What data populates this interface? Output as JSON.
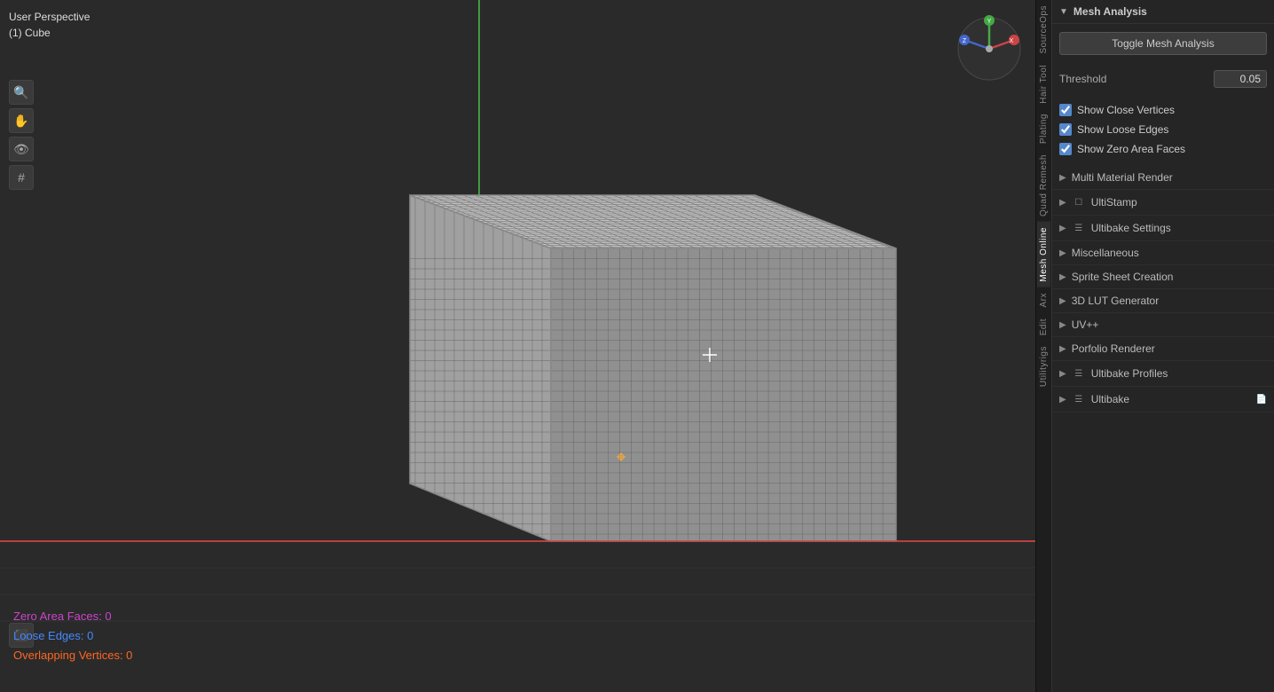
{
  "viewport": {
    "label_line1": "User Perspective",
    "label_line2": "(1) Cube"
  },
  "stats": {
    "zero_area": "Zero Area Faces: 0",
    "loose_edges": "Loose Edges: 0",
    "overlapping": "Overlapping Vertices: 0"
  },
  "toolbar": {
    "icons": [
      "🔍",
      "✋",
      "🎭",
      "⬛"
    ]
  },
  "right_panel": {
    "mesh_analysis_title": "Mesh Analysis",
    "toggle_button_label": "Toggle Mesh Analysis",
    "threshold_label": "Threshold",
    "threshold_value": "0.05",
    "show_close_vertices": true,
    "show_close_vertices_label": "Show Close Vertices",
    "show_loose_edges": true,
    "show_loose_edges_label": "Show Loose Edges",
    "show_zero_area_faces": true,
    "show_zero_area_faces_label": "Show Zero Area Faces",
    "collapsed_sections": [
      {
        "label": "Multi Material Render",
        "icon": null
      },
      {
        "label": "UltiStamp",
        "icon": "checkbox"
      },
      {
        "label": "Ultibake Settings",
        "icon": "list"
      },
      {
        "label": "Miscellaneous",
        "icon": null
      },
      {
        "label": "Sprite Sheet Creation",
        "icon": null
      },
      {
        "label": "3D LUT Generator",
        "icon": null
      },
      {
        "label": "UV++",
        "icon": null
      },
      {
        "label": "Porfolio Renderer",
        "icon": null
      },
      {
        "label": "Ultibake Profiles",
        "icon": "list2"
      },
      {
        "label": "Ultibake",
        "icon": "list3"
      }
    ]
  },
  "tab_strip": {
    "tabs": [
      "SourceOps",
      "Hair Tool",
      "Plating",
      "Quad Remesh",
      "Mesh Online",
      "Arx",
      "Edit",
      "Utilityrigs"
    ]
  }
}
